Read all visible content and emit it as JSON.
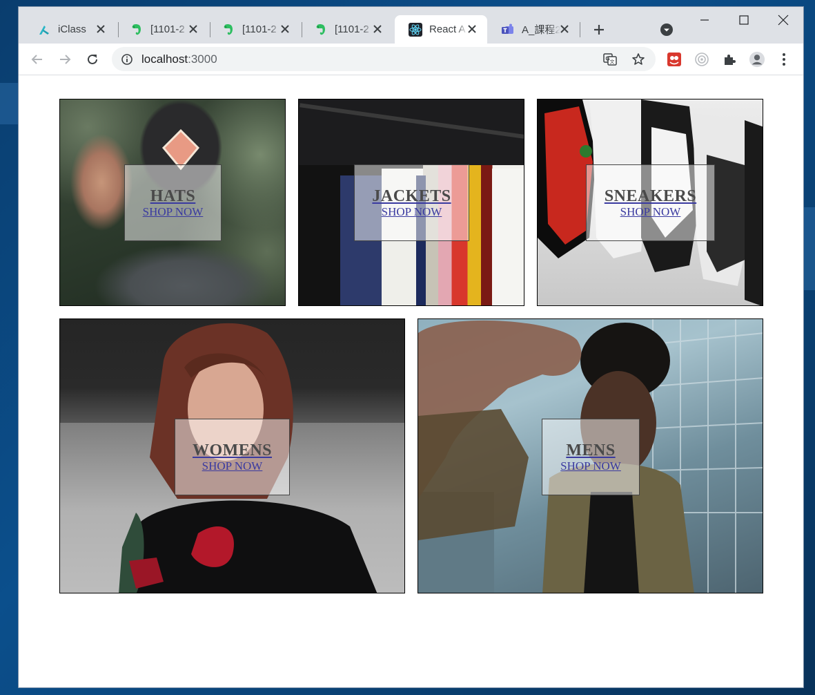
{
  "browser": {
    "tabs": [
      {
        "title": "iClass",
        "icon": "iclass-icon",
        "active": false
      },
      {
        "title": "[1101-2",
        "icon": "evernote-icon",
        "active": false
      },
      {
        "title": "[1101-2",
        "icon": "evernote-icon",
        "active": false
      },
      {
        "title": "[1101-2",
        "icon": "evernote-icon",
        "active": false
      },
      {
        "title": "React A",
        "icon": "react-icon",
        "active": true
      },
      {
        "title": "A_課程2",
        "icon": "teams-icon",
        "active": false
      }
    ],
    "url_host": "localhost",
    "url_port": ":3000"
  },
  "directory": {
    "sections": [
      {
        "title": "HATS",
        "subtitle": "SHOP NOW",
        "theme": "#3b3f34"
      },
      {
        "title": "JACKETS",
        "subtitle": "SHOP NOW",
        "theme": "#2a2a2a"
      },
      {
        "title": "SNEAKERS",
        "subtitle": "SHOP NOW",
        "theme": "#9a9a9a"
      },
      {
        "title": "WOMENS",
        "subtitle": "SHOP NOW",
        "theme": "#2b2b2b"
      },
      {
        "title": "MENS",
        "subtitle": "SHOP NOW",
        "theme": "#6f8ea0"
      }
    ]
  }
}
